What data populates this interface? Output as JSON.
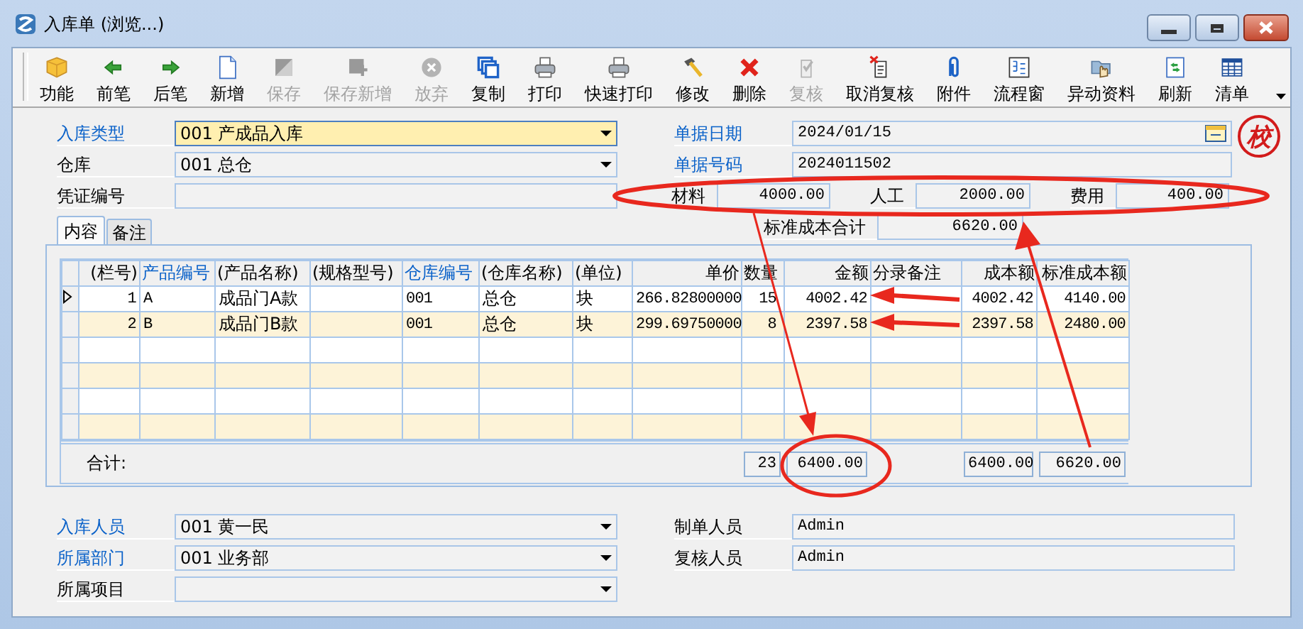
{
  "window": {
    "title": "入库单 (浏览...)"
  },
  "toolbar": [
    {
      "label": "功能",
      "disabled": false
    },
    {
      "label": "前笔",
      "disabled": false
    },
    {
      "label": "后笔",
      "disabled": false
    },
    {
      "label": "新增",
      "disabled": false
    },
    {
      "label": "保存",
      "disabled": true
    },
    {
      "label": "保存新增",
      "disabled": true
    },
    {
      "label": "放弃",
      "disabled": true
    },
    {
      "label": "复制",
      "disabled": false
    },
    {
      "label": "打印",
      "disabled": false
    },
    {
      "label": "快速打印",
      "disabled": false
    },
    {
      "label": "修改",
      "disabled": false
    },
    {
      "label": "删除",
      "disabled": false
    },
    {
      "label": "复核",
      "disabled": true
    },
    {
      "label": "取消复核",
      "disabled": false
    },
    {
      "label": "附件",
      "disabled": false
    },
    {
      "label": "流程窗",
      "disabled": false
    },
    {
      "label": "异动资料",
      "disabled": false
    },
    {
      "label": "刷新",
      "disabled": false
    },
    {
      "label": "清单",
      "disabled": false
    }
  ],
  "header": {
    "left": [
      {
        "label": "入库类型",
        "required": true,
        "kind": "select",
        "value": "001 产成品入库",
        "focused": true
      },
      {
        "label": "仓库",
        "required": false,
        "kind": "select",
        "value": "001 总仓",
        "focused": false
      },
      {
        "label": "凭证编号",
        "required": false,
        "kind": "text",
        "focused": false
      }
    ],
    "right": [
      {
        "label": "单据日期",
        "required": true,
        "kind": "date",
        "value": "2024/01/15"
      },
      {
        "label": "单据号码",
        "required": true,
        "kind": "text",
        "value": "2024011502"
      }
    ],
    "stamp": "校",
    "costs": [
      {
        "label": "材料",
        "value": "4000.00"
      },
      {
        "label": "人工",
        "value": "2000.00"
      },
      {
        "label": "费用",
        "value": "400.00"
      }
    ],
    "standard_total": {
      "label": "标准成本合计",
      "value": "6620.00"
    }
  },
  "tabs": [
    {
      "label": "内容",
      "selected": true
    },
    {
      "label": "备注",
      "selected": false
    }
  ],
  "table": {
    "columns": [
      {
        "label": "(栏号)",
        "required": false,
        "kind": "number"
      },
      {
        "label": "产品编号",
        "required": true,
        "kind": "text"
      },
      {
        "label": "(产品名称)",
        "required": false,
        "kind": "text"
      },
      {
        "label": "(规格型号)",
        "required": false,
        "kind": "text"
      },
      {
        "label": "仓库编号",
        "required": true,
        "kind": "text"
      },
      {
        "label": "(仓库名称)",
        "required": false,
        "kind": "text"
      },
      {
        "label": "(单位)",
        "required": false,
        "kind": "text"
      },
      {
        "label": "单价",
        "required": false,
        "kind": "number"
      },
      {
        "label": "数量",
        "required": false,
        "kind": "text"
      },
      {
        "label": "金额",
        "required": false,
        "kind": "number"
      },
      {
        "label": "分录备注",
        "required": false,
        "kind": "text"
      },
      {
        "label": "成本额",
        "required": false,
        "kind": "number"
      },
      {
        "label": "标准成本额",
        "required": false,
        "kind": "number"
      }
    ],
    "rows": [
      {
        "current": true,
        "cells": [
          "1",
          "A",
          "成品门A款",
          "",
          "001",
          "总仓",
          "块",
          "266.82800000",
          "15",
          "4002.42",
          "",
          "4002.42",
          "4140.00"
        ]
      },
      {
        "current": false,
        "cells": [
          "2",
          "B",
          "成品门B款",
          "",
          "001",
          "总仓",
          "块",
          "299.69750000",
          "8",
          "2397.58",
          "",
          "2397.58",
          "2480.00"
        ]
      }
    ],
    "footer": {
      "label": "合计:",
      "quantity": "23",
      "amount": "6400.00",
      "cost": "6400.00",
      "standard_cost": "6620.00"
    }
  },
  "footer_fields": {
    "left": [
      {
        "label": "入库人员",
        "required": true,
        "value": "001 黄一民"
      },
      {
        "label": "所属部门",
        "required": true,
        "value": "001 业务部"
      },
      {
        "label": "所属项目",
        "required": false
      }
    ],
    "right": [
      {
        "label": "制单人员",
        "value": "Admin"
      },
      {
        "label": "复核人员",
        "value": "Admin"
      }
    ]
  }
}
